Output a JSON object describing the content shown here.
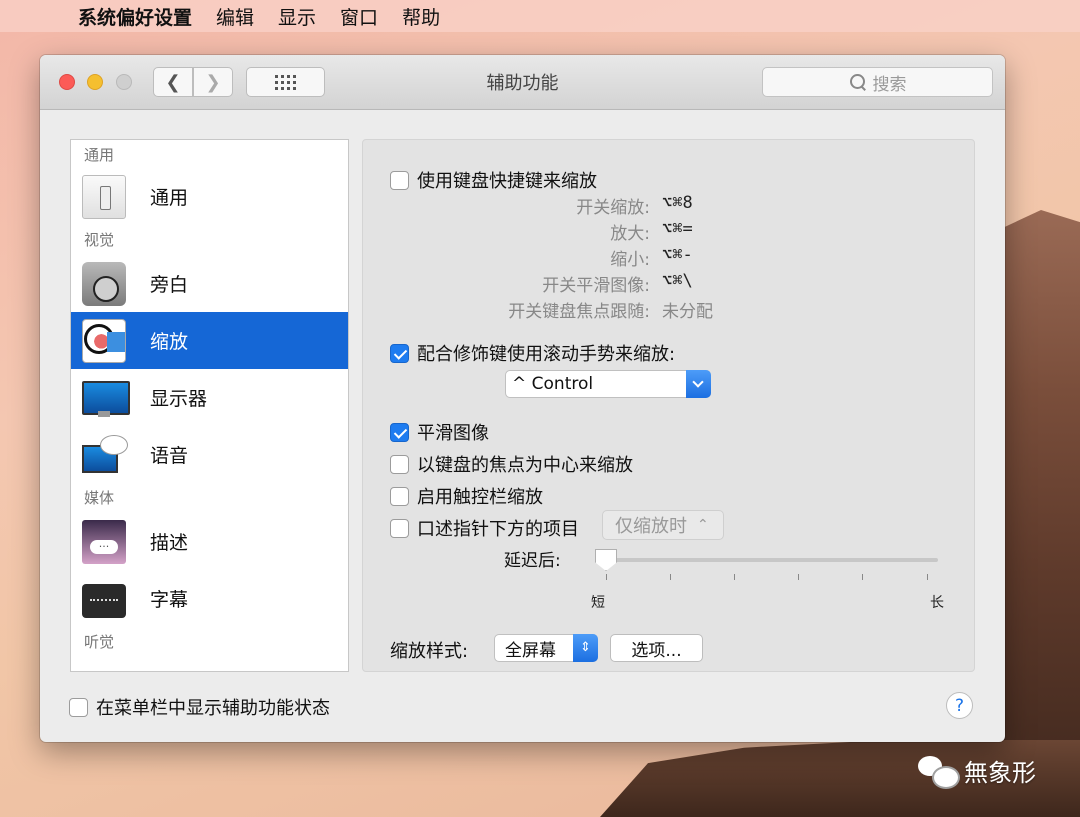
{
  "menubar": {
    "app_name": "系统偏好设置",
    "items": [
      "编辑",
      "显示",
      "窗口",
      "帮助"
    ]
  },
  "window": {
    "title": "辅助功能",
    "search_placeholder": "搜索"
  },
  "sidebar": {
    "sections": {
      "general": "通用",
      "vision": "视觉",
      "media": "媒体",
      "hearing": "听觉"
    },
    "items": [
      {
        "label": "通用",
        "icon": "general-icon"
      },
      {
        "label": "旁白",
        "icon": "voiceover-icon"
      },
      {
        "label": "缩放",
        "icon": "zoom-icon",
        "selected": true
      },
      {
        "label": "显示器",
        "icon": "display-icon"
      },
      {
        "label": "语音",
        "icon": "speech-icon"
      },
      {
        "label": "描述",
        "icon": "descriptions-icon"
      },
      {
        "label": "字幕",
        "icon": "captions-icon"
      }
    ]
  },
  "panel": {
    "keyboard_shortcuts": {
      "label": "使用键盘快捷键来缩放",
      "checked": false
    },
    "shortcuts": [
      {
        "label": "开关缩放:",
        "key": "⌥⌘8"
      },
      {
        "label": "放大:",
        "key": "⌥⌘="
      },
      {
        "label": "缩小:",
        "key": "⌥⌘-"
      },
      {
        "label": "开关平滑图像:",
        "key": "⌥⌘\\"
      },
      {
        "label": "开关键盘焦点跟随:",
        "key": "未分配"
      }
    ],
    "scroll_gesture": {
      "label": "配合修饰键使用滚动手势来缩放:",
      "checked": true
    },
    "modifier_select": {
      "value": "^ Control"
    },
    "smooth_images": {
      "label": "平滑图像",
      "checked": true
    },
    "follow_keyboard_focus": {
      "label": "以键盘的焦点为中心来缩放",
      "checked": false
    },
    "touch_bar_zoom": {
      "label": "启用触控栏缩放",
      "checked": false
    },
    "speak_items": {
      "label": "口述指针下方的项目",
      "checked": false
    },
    "speak_mode_select": {
      "value": "仅缩放时"
    },
    "delay": {
      "label": "延迟后:",
      "min_label": "短",
      "max_label": "长",
      "value": 0
    },
    "zoom_style": {
      "label": "缩放样式:",
      "value": "全屏幕"
    },
    "options_button": "选项..."
  },
  "footer": {
    "show_status": {
      "label": "在菜单栏中显示辅助功能状态",
      "checked": false
    },
    "help": "?"
  },
  "watermark": {
    "text": "無象形"
  },
  "colors": {
    "accent": "#1567d6",
    "checkbox_on": "#1e7cf0",
    "close": "#fc5b57",
    "minimize": "#f5bf2f"
  }
}
